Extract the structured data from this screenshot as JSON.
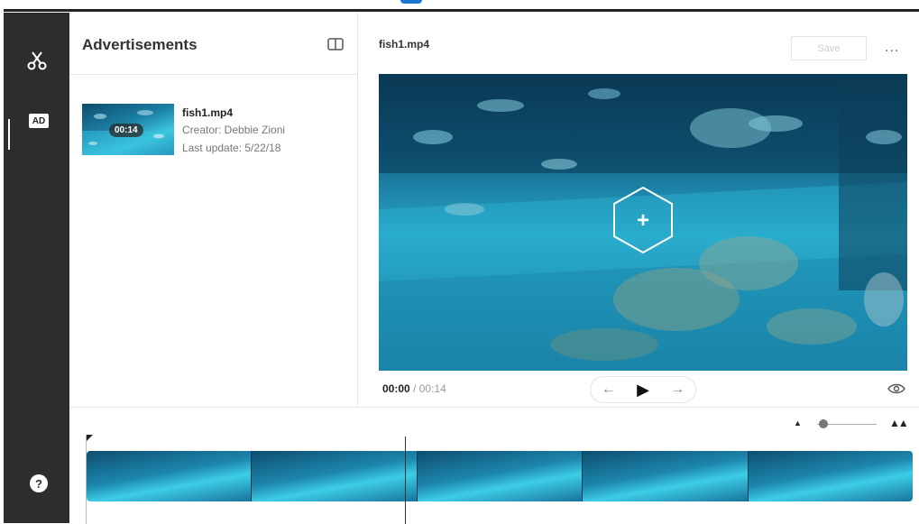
{
  "rail": {
    "ad_label": "AD",
    "help_label": "?"
  },
  "library": {
    "title": "Advertisements",
    "items": [
      {
        "name": "fish1.mp4",
        "duration": "00:14",
        "creator": "Creator: Debbie Zioni",
        "updated": "Last update: 5/22/18"
      }
    ]
  },
  "editor": {
    "filename": "fish1.mp4",
    "save_label": "Save",
    "more_label": "...",
    "time_current": "00:00",
    "time_sep": "/",
    "time_total": "00:14",
    "add_label": "+",
    "prev_label": "←",
    "play_label": "▶",
    "next_label": "→"
  },
  "timeline": {
    "zoom_out_label": "▲",
    "zoom_in_label": "▲▲",
    "zoom_level": 0.1,
    "frames": 5
  },
  "colors": {
    "rail": "#2d2d2d",
    "accent": "#1976d2",
    "water_light": "#3fc8e0",
    "water_dark": "#0e4c6e"
  }
}
